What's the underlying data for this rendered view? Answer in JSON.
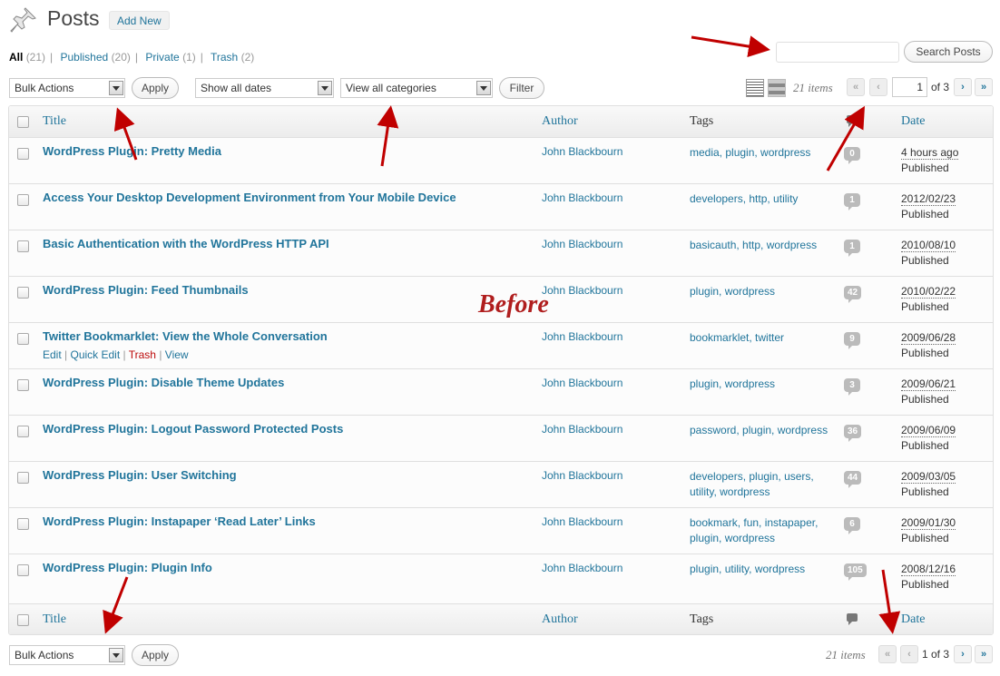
{
  "header": {
    "title": "Posts",
    "add_new": "Add New"
  },
  "views": [
    {
      "label": "All",
      "count": "(21)"
    },
    {
      "label": "Published",
      "count": "(20)"
    },
    {
      "label": "Private",
      "count": "(1)"
    },
    {
      "label": "Trash",
      "count": "(2)"
    }
  ],
  "search": {
    "value": "",
    "button": "Search Posts"
  },
  "nav_top": {
    "bulk_actions": "Bulk Actions",
    "apply": "Apply",
    "dates": "Show all dates",
    "categories": "View all categories",
    "filter": "Filter",
    "items": "21 items",
    "first": "«",
    "prev": "‹",
    "current_page": "1",
    "of": "of 3",
    "next": "›",
    "last": "»"
  },
  "columns": {
    "title": "Title",
    "author": "Author",
    "tags": "Tags",
    "date": "Date"
  },
  "posts": [
    {
      "title": "WordPress Plugin: Pretty Media",
      "author": "John Blackbourn",
      "tags": "media, plugin, wordpress",
      "comments": "0",
      "date": "4 hours ago",
      "status": "Published"
    },
    {
      "title": "Access Your Desktop Development Environment from Your Mobile Device",
      "author": "John Blackbourn",
      "tags": "developers, http, utility",
      "comments": "1",
      "date": "2012/02/23",
      "status": "Published"
    },
    {
      "title": "Basic Authentication with the WordPress HTTP API",
      "author": "John Blackbourn",
      "tags": "basicauth, http, wordpress",
      "comments": "1",
      "date": "2010/08/10",
      "status": "Published"
    },
    {
      "title": "WordPress Plugin: Feed Thumbnails",
      "author": "John Blackbourn",
      "tags": "plugin, wordpress",
      "comments": "42",
      "date": "2010/02/22",
      "status": "Published"
    },
    {
      "title": "Twitter Bookmarklet: View the Whole Conversation",
      "author": "John Blackbourn",
      "tags": "bookmarklet, twitter",
      "comments": "9",
      "date": "2009/06/28",
      "status": "Published",
      "actions": {
        "edit": "Edit",
        "quick_edit": "Quick Edit",
        "trash": "Trash",
        "view": "View"
      }
    },
    {
      "title": "WordPress Plugin: Disable Theme Updates",
      "author": "John Blackbourn",
      "tags": "plugin, wordpress",
      "comments": "3",
      "date": "2009/06/21",
      "status": "Published"
    },
    {
      "title": "WordPress Plugin: Logout Password Protected Posts",
      "author": "John Blackbourn",
      "tags": "password, plugin, wordpress",
      "comments": "36",
      "date": "2009/06/09",
      "status": "Published"
    },
    {
      "title": "WordPress Plugin: User Switching",
      "author": "John Blackbourn",
      "tags": "developers, plugin, users, utility, wordpress",
      "comments": "44",
      "date": "2009/03/05",
      "status": "Published"
    },
    {
      "title": "WordPress Plugin: Instapaper ‘Read Later’ Links",
      "author": "John Blackbourn",
      "tags": "bookmark, fun, instapaper, plugin, wordpress",
      "comments": "6",
      "date": "2009/01/30",
      "status": "Published"
    },
    {
      "title": "WordPress Plugin: Plugin Info",
      "author": "John Blackbourn",
      "tags": "plugin, utility, wordpress",
      "comments": "105",
      "date": "2008/12/16",
      "status": "Published"
    }
  ],
  "annotation": {
    "label": "Before"
  },
  "nav_bottom": {
    "bulk_actions": "Bulk Actions",
    "apply": "Apply",
    "items": "21 items",
    "first": "«",
    "prev": "‹",
    "page_of": "1 of 3",
    "next": "›",
    "last": "»"
  },
  "colors": {
    "link": "#21759b",
    "arrow": "#c00000",
    "trash": "#bc0b0b"
  }
}
